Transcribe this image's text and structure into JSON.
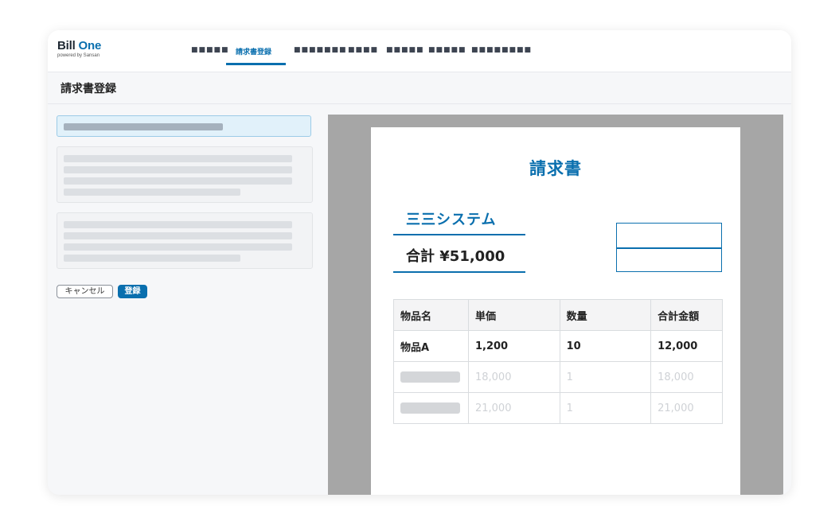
{
  "app": {
    "logo_main_1": "Bill ",
    "logo_main_2": "One",
    "logo_sub": "powered by Sansan"
  },
  "nav": {
    "items": [
      {
        "label": "■■■■■"
      },
      {
        "label": "請求書登録",
        "active": true
      },
      {
        "label": "■■■■■■■"
      },
      {
        "label": "■■■■"
      },
      {
        "label": "■■■■■"
      },
      {
        "label": "■■■■■"
      },
      {
        "label": "■■■■■■■■"
      }
    ]
  },
  "page": {
    "title": "請求書登録"
  },
  "form": {
    "cancel_label": "キャンセル",
    "submit_label": "登録"
  },
  "invoice": {
    "title": "請求書",
    "company": "三三システム",
    "total": "合計 ¥51,000",
    "table": {
      "headers": [
        "物品名",
        "単価",
        "数量",
        "合計金額"
      ],
      "rows": [
        {
          "name": "物品A",
          "unit_price": "1,200",
          "qty": "10",
          "amount": "12,000"
        },
        {
          "name": "",
          "unit_price": "18,000",
          "qty": "1",
          "amount": "18,000"
        },
        {
          "name": "",
          "unit_price": "21,000",
          "qty": "1",
          "amount": "21,000"
        }
      ]
    }
  },
  "colors": {
    "accent": "#0a6fae",
    "preview_bg": "#a6a6a6"
  }
}
